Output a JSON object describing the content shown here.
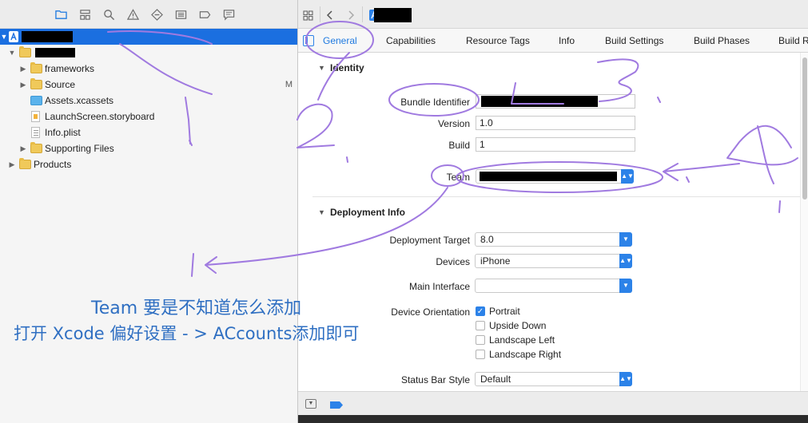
{
  "navigator": {
    "items": [
      {
        "label": "frameworks"
      },
      {
        "label": "Source",
        "badge": "M"
      },
      {
        "label": "Assets.xcassets"
      },
      {
        "label": "LaunchScreen.storyboard"
      },
      {
        "label": "Info.plist"
      },
      {
        "label": "Supporting Files"
      },
      {
        "label": "Products"
      }
    ]
  },
  "tabs": [
    "General",
    "Capabilities",
    "Resource Tags",
    "Info",
    "Build Settings",
    "Build Phases",
    "Build R"
  ],
  "identity": {
    "heading": "Identity",
    "bundle_identifier_label": "Bundle Identifier",
    "version_label": "Version",
    "version_value": "1.0",
    "build_label": "Build",
    "build_value": "1",
    "team_label": "Team"
  },
  "deployment": {
    "heading": "Deployment Info",
    "target_label": "Deployment Target",
    "target_value": "8.0",
    "devices_label": "Devices",
    "devices_value": "iPhone",
    "main_interface_label": "Main Interface",
    "main_interface_value": "",
    "orientation_label": "Device Orientation",
    "orientations": [
      {
        "label": "Portrait",
        "checked": true
      },
      {
        "label": "Upside Down",
        "checked": false
      },
      {
        "label": "Landscape Left",
        "checked": false
      },
      {
        "label": "Landscape Right",
        "checked": false
      }
    ],
    "status_bar_label": "Status Bar Style",
    "status_bar_value": "Default"
  },
  "annotations": {
    "line1": "Team 要是不知道怎么添加",
    "line2": "打开 Xcode 偏好设置 - > ACcounts添加即可",
    "ink_color": "#a07ae0",
    "text_color": "#2f6fc2"
  }
}
